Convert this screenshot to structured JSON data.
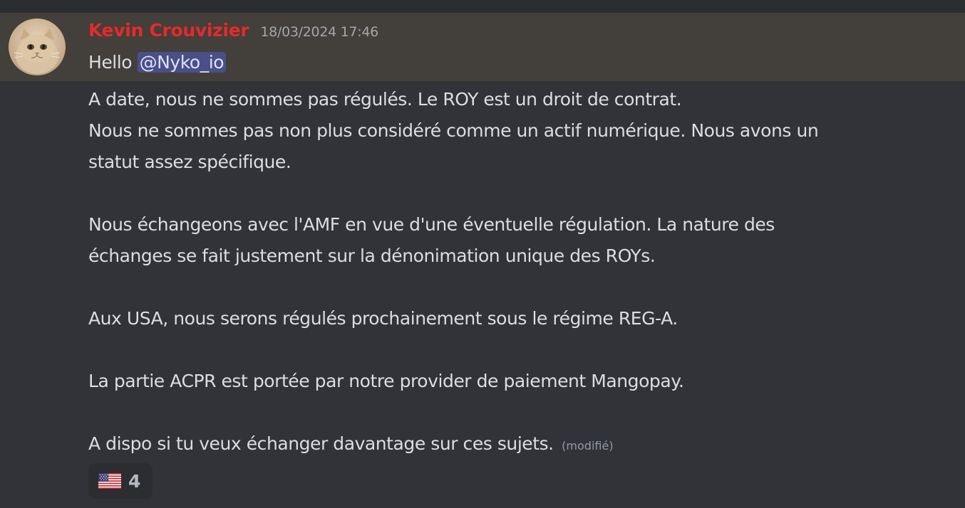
{
  "message": {
    "author": "Kevin Crouvizier",
    "timestamp": "18/03/2024 17:46",
    "greeting": "Hello",
    "mention": "@Nyko_io",
    "lines": [
      "A date, nous ne sommes pas régulés. Le ROY est un droit de contrat.",
      "Nous ne sommes pas non plus considéré comme un actif numérique. Nous avons un",
      "statut assez spécifique.",
      "Nous échangeons avec l'AMF en vue d'une éventuelle régulation. La nature des",
      "échanges se fait justement sur la dénonimation unique des ROYs.",
      "Aux USA, nous serons régulés prochainement sous le régime REG-A.",
      "La partie ACPR est portée par notre provider de paiement Mangopay.",
      "A dispo si tu veux échanger davantage sur ces sujets."
    ],
    "edited_label": "(modifié)",
    "reaction": {
      "emoji": "flag-us-icon",
      "count": "4"
    }
  },
  "colors": {
    "background": "#313338",
    "highlight": "#433f3a",
    "author": "#e62a2a",
    "mention_bg": "#4a4f87"
  }
}
